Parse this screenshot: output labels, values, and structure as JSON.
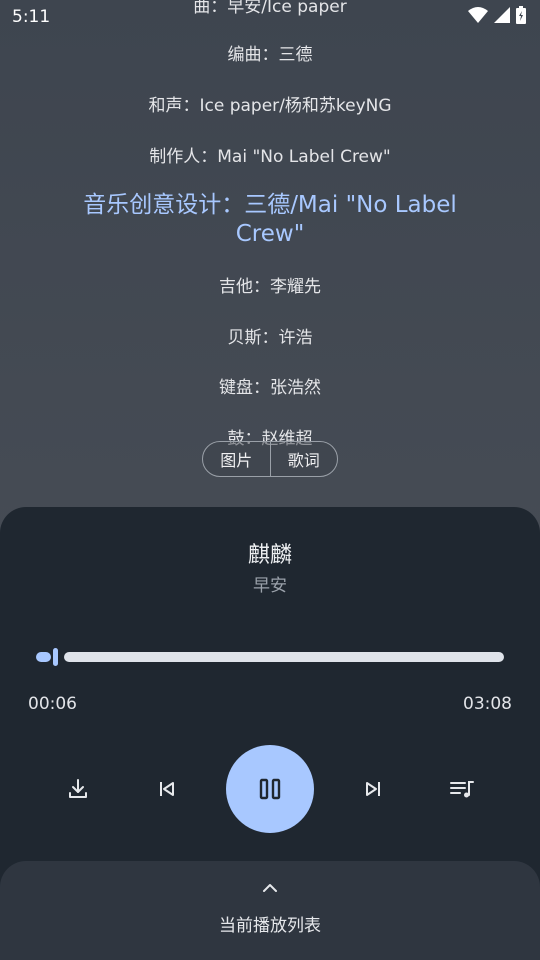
{
  "status": {
    "time": "5:11"
  },
  "lyrics": [
    "曲：早安/Ice paper",
    "编曲：三德",
    "和声：Ice paper/杨和苏keyNG",
    "制作人：Mai \"No Label Crew\"",
    "音乐创意设计：三德/Mai \"No Label Crew\"",
    "吉他：李耀先",
    "贝斯：许浩",
    "键盘：张浩然",
    "鼓：赵维超"
  ],
  "active_lyric_index": 4,
  "view_toggle": {
    "image_label": "图片",
    "lyrics_label": "歌词"
  },
  "song": {
    "title": "麒麟",
    "artist": "早安"
  },
  "progress": {
    "current": "00:06",
    "total": "03:08",
    "fraction": 0.032
  },
  "controls": {
    "download_icon": "download-icon",
    "previous_icon": "skip-previous-icon",
    "play_pause_icon": "pause-icon",
    "next_icon": "skip-next-icon",
    "queue_icon": "playlist-music-icon"
  },
  "queue": {
    "label": "当前播放列表",
    "icon": "chevron-up-icon"
  },
  "colors": {
    "accent": "#a8c8ff",
    "panel": "#1f2730",
    "queue_panel": "#2f3640"
  }
}
